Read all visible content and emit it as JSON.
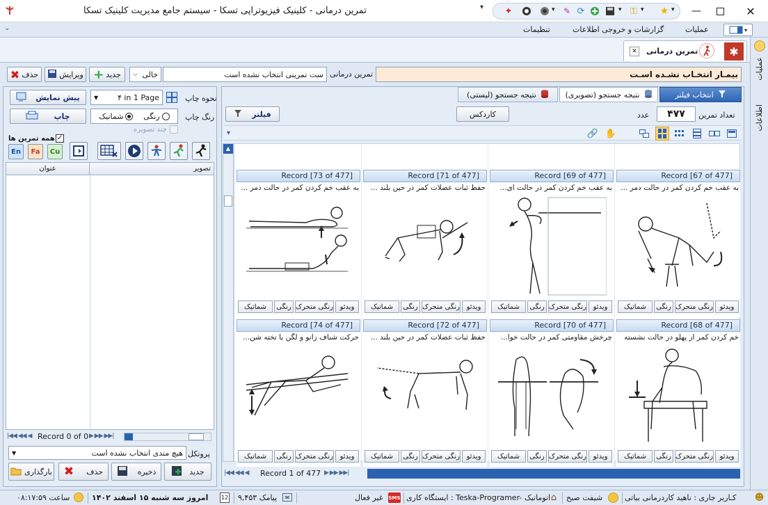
{
  "title": {
    "app": "تمرین درمانی - کلینیک فیزیوتراپی تسکا - سیستم جامع مدیریت کلینیک تسکا"
  },
  "menu": {
    "operations": "عملیات",
    "reports": "گزارشات و خروجی اطلاعات",
    "settings": "تنظیمات"
  },
  "doc_tab": {
    "label": "تمرین درمانی"
  },
  "side_strip": {
    "operations": "عملیات",
    "info": "اطلاعات"
  },
  "toolbar": {
    "patient_banner": "بیمـار انتخـاب نشـده اسـت",
    "exercise_label": "تمرین درمانی",
    "exercise_value": "ست تمرینی انتخاب نشده است",
    "empty_select": "خالی",
    "new": "جدید",
    "edit": "ویرایش",
    "delete": "حذف"
  },
  "print": {
    "type_label": "نحوه چاپ",
    "type_value": "۴ in 1 Page",
    "color_label": "رنگ چاپ",
    "color_option": "رنگی",
    "schematic_option": "شماتیک",
    "multi_image": "چند تصویره",
    "preview": "پیش نمایش",
    "print": "چاپ"
  },
  "all_exercises": "همه تمرین ها",
  "lang": {
    "en": "En",
    "fa": "Fa",
    "cu": "Cu"
  },
  "list": {
    "col_image": "تصویر",
    "col_title": "عنوان",
    "record": "Record 0 of 0"
  },
  "protocol": {
    "label": "پروتکل",
    "value": "هیچ متدی انتخاب نشده است"
  },
  "bottom_buttons": {
    "new": "جدید",
    "save": "ذخیره",
    "delete": "حذف",
    "load": "بارگذاری"
  },
  "right_tabs": {
    "filter_select": "انتخاب فیلتر",
    "image_results": "(نتیجه جستجو (تصویری",
    "list_results": "(نتیجه جستجو (لیستی"
  },
  "filterbar": {
    "count_label": "تعداد تمرین",
    "count_value": "۴۷۷",
    "count_unit": "عدد",
    "cardex": "کاردکس",
    "filter": "فیلتر"
  },
  "card_buttons": {
    "video": "ویدئو",
    "animated_color": "رنگی متحرک",
    "color": "رنگی",
    "schematic": "شماتیک"
  },
  "cards": [
    {
      "record": "Record [67 of 477]",
      "title": "به عقب خم کردن کمر در حالت دمر ...",
      "icon": "bent-over-chair-figure-icon"
    },
    {
      "record": "Record [69 of 477]",
      "title": "به عقب خم کردن کمر در حالت ای...",
      "icon": "standing-backbend-figure-icon"
    },
    {
      "record": "Record [71 of 477]",
      "title": "حفظ ثبات عضلات کمر در حین بلند ...",
      "icon": "quadruped-arm-raise-figure-icon"
    },
    {
      "record": "Record [73 of 477]",
      "title": "به عقب خم کردن کمر در حالت دمر ...",
      "icon": "prone-press-up-figure-icon"
    },
    {
      "record": "Record [68 of 477]",
      "title": "خم کردن کمر از پهلو در حالت نشسته",
      "icon": "seated-side-bend-figure-icon"
    },
    {
      "record": "Record [70 of 477]",
      "title": "چرخش مقاومتی کمر در حالت خوا...",
      "icon": "supine-rotation-figure-icon"
    },
    {
      "record": "Record [72 of 477]",
      "title": "حفظ ثبات عضلات کمر در حین بلند ...",
      "icon": "quadruped-leg-raise-figure-icon"
    },
    {
      "record": "Record [74 of 477]",
      "title": "حرکت شناف زانو و لگن با تخته شن...",
      "icon": "prone-knee-bend-board-figure-icon"
    }
  ],
  "pager": {
    "record": "Record 1 of 477"
  },
  "status": {
    "user": "کـاربر جاری : ناهید کاردرمانی بیاتی",
    "shift": "شیفت صبح",
    "station": "ایستگاه کاری : Teska-Programer- اتوماتیک",
    "sms": "غیر فعال",
    "messages": "۹,۴۵۳ پیامک",
    "date": "امروز سه شنبه ۱۵ اسفند ۱۴۰۲",
    "time": "ساعت ۰۸:۱۷:۵۹",
    "calendar_day": "12"
  },
  "colors": {
    "accent": "#2a62b0",
    "banner": "#fdebd8",
    "frame": "#dfe8f3"
  }
}
